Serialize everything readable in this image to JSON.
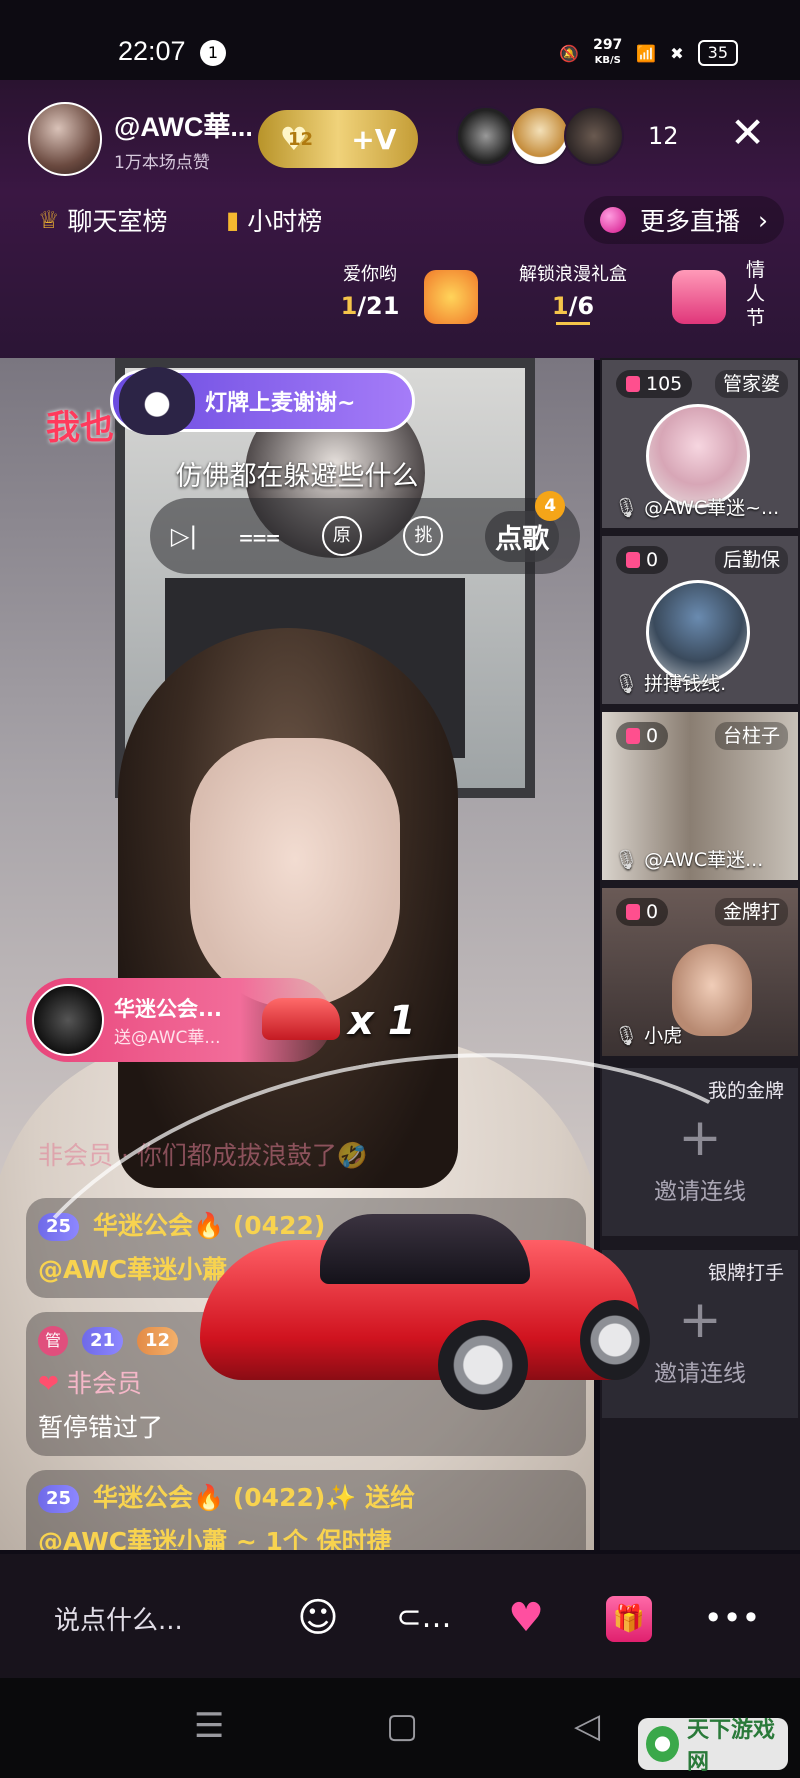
{
  "status": {
    "time": "22:07",
    "notif_count": "1",
    "net_speed": "297",
    "net_unit": "KB/S",
    "battery": "35"
  },
  "header": {
    "anchor_name": "@AWC華...",
    "anchor_likes": "1万本场点赞",
    "fan_level": "12",
    "fan_follow": "+V",
    "viewer_count": "12",
    "tabs": [
      {
        "label": "聊天室榜",
        "icon": "crown-icon"
      },
      {
        "label": "小时榜",
        "icon": "bar-chart-icon"
      }
    ],
    "more_live": "更多直播",
    "tasks": [
      {
        "title": "爱你哟",
        "progress_done": "1",
        "progress_total": "/21"
      },
      {
        "title": "解锁浪漫礼盒",
        "progress_done": "1",
        "progress_total": "/6"
      }
    ],
    "valentine": [
      "情",
      "人",
      "节"
    ]
  },
  "video": {
    "mic_card": "灯牌上麦谢谢~",
    "red_text": "我也",
    "lyric": "仿佛都在躲避些什么",
    "song_button": "点歌",
    "song_badge": "4",
    "player_buttons": [
      "▷|",
      "ᴛ",
      "原",
      "挑"
    ],
    "gift_banner": {
      "name": "华迷公会...",
      "sub": "送@AWC華...",
      "multiplier": "x 1"
    },
    "comments": [
      {
        "text": "非会员 · 你们都成拔浪鼓了🤣"
      },
      {
        "level": "25",
        "name": "华迷公会🔥 (0422)",
        "line2": "@AWC華迷小蕭~"
      },
      {
        "admin": "管",
        "level": "21",
        "level2": "12",
        "name": "非会员",
        "line2": "暂停错过了"
      },
      {
        "level": "25",
        "name": "华迷公会🔥 (0422)✨ 送给",
        "line2": "@AWC華迷小蕭 ~ 1个 保时捷"
      }
    ]
  },
  "seats": [
    {
      "count": "105",
      "role": "管家婆",
      "name": "@AWC華迷~..."
    },
    {
      "count": "0",
      "role": "后勤保",
      "name": "拼搏钱线."
    },
    {
      "count": "0",
      "role": "台柱子",
      "name": "@AWC華迷..."
    },
    {
      "count": "0",
      "role": "金牌打",
      "name": "小虎"
    },
    {
      "title": "我的金牌",
      "invite": "邀请连线"
    },
    {
      "title": "银牌打手",
      "invite": "邀请连线"
    }
  ],
  "bottom": {
    "say_placeholder": "说点什么..."
  },
  "watermark": "天下游戏网"
}
